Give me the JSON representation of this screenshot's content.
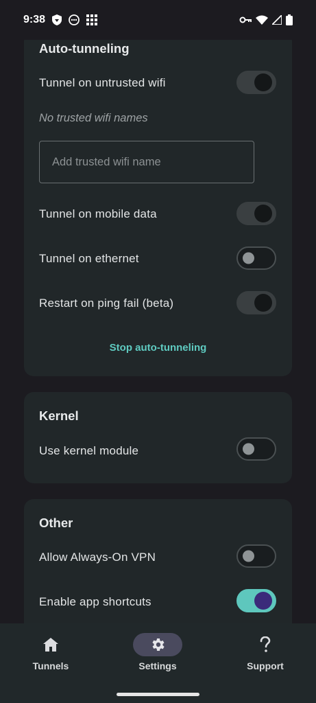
{
  "status_bar": {
    "time": "9:38",
    "icons": [
      "vpn-shield-icon",
      "messaging-icon",
      "grid-app-icon",
      "vpn-key-icon",
      "wifi-icon",
      "signal-icon",
      "battery-icon"
    ]
  },
  "auto_tunneling": {
    "title": "Auto-tunneling",
    "untrusted_wifi_label": "Tunnel on untrusted wifi",
    "untrusted_wifi_on": true,
    "no_trusted_hint": "No trusted wifi names",
    "trusted_input_placeholder": "Add trusted wifi name",
    "trusted_input_value": "",
    "mobile_data_label": "Tunnel on mobile data",
    "mobile_data_on": true,
    "ethernet_label": "Tunnel on ethernet",
    "ethernet_on": false,
    "ping_fail_label": "Restart on ping fail (beta)",
    "ping_fail_on": true,
    "stop_button": "Stop auto-tunneling"
  },
  "kernel": {
    "title": "Kernel",
    "kernel_module_label": "Use kernel module",
    "kernel_module_on": false
  },
  "other": {
    "title": "Other",
    "always_on_label": "Allow Always-On VPN",
    "always_on_on": false,
    "shortcuts_label": "Enable app shortcuts",
    "shortcuts_on": true
  },
  "nav": {
    "tunnels": "Tunnels",
    "settings": "Settings",
    "support": "Support",
    "active": "settings"
  },
  "colors": {
    "accent": "#5fcbc1",
    "card": "#212729",
    "background": "#1c1b20"
  }
}
